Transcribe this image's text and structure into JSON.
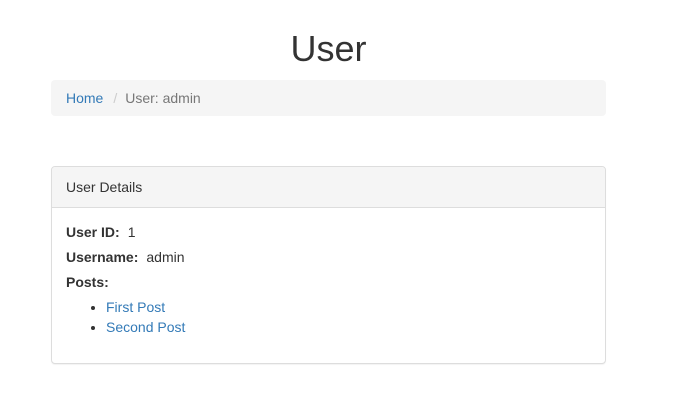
{
  "page": {
    "title": "User"
  },
  "breadcrumb": {
    "home": "Home",
    "separator": "/",
    "current": "User: admin"
  },
  "panel": {
    "heading": "User Details",
    "user_id_label": "User ID:",
    "user_id_value": "1",
    "username_label": "Username:",
    "username_value": "admin",
    "posts_label": "Posts:",
    "posts": [
      "First Post",
      "Second Post"
    ]
  },
  "colors": {
    "link": "#337ab7",
    "text": "#333333",
    "muted": "#777777",
    "panel_heading_bg": "#f5f5f5",
    "border": "#dddddd"
  }
}
